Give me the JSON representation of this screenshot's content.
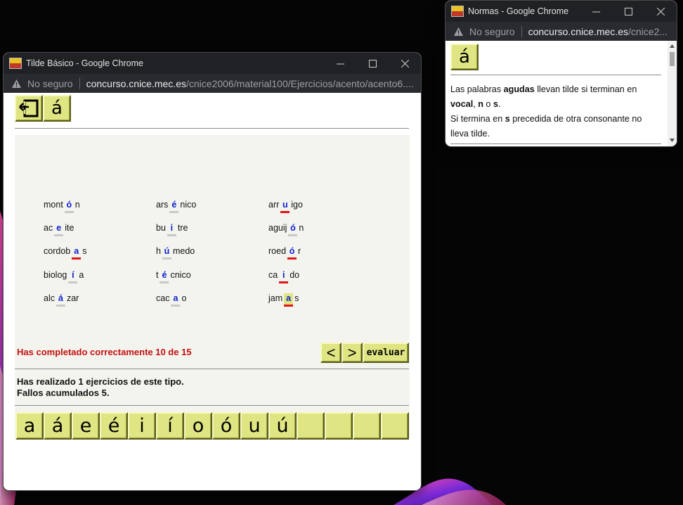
{
  "main_window": {
    "title": "Tilde Básico - Google Chrome",
    "security": "No seguro",
    "url_host": "concurso.cnice.mec.es",
    "url_path": "/cnice2006/material100/Ejercicios/acento/acento6....",
    "exit_icon": "exit-icon",
    "accent_button": "á",
    "words": [
      {
        "pre": "mont",
        "letter": "ó",
        "post": "n",
        "state": "neutral"
      },
      {
        "pre": "ac",
        "letter": "e",
        "post": "ite",
        "state": "neutral"
      },
      {
        "pre": "cordob",
        "letter": "a",
        "post": "s",
        "state": "error"
      },
      {
        "pre": "biolog",
        "letter": "í",
        "post": "a",
        "state": "neutral"
      },
      {
        "pre": "alc",
        "letter": "á",
        "post": "zar",
        "state": "neutral"
      },
      {
        "pre": "ars",
        "letter": "é",
        "post": "nico",
        "state": "neutral"
      },
      {
        "pre": "bu",
        "letter": "i",
        "post": "tre",
        "state": "neutral"
      },
      {
        "pre": "h",
        "letter": "ú",
        "post": "medo",
        "state": "neutral"
      },
      {
        "pre": "t",
        "letter": "é",
        "post": "cnico",
        "state": "neutral"
      },
      {
        "pre": "cac",
        "letter": "a",
        "post": "o",
        "state": "neutral"
      },
      {
        "pre": "arr",
        "letter": "u",
        "post": "igo",
        "state": "error"
      },
      {
        "pre": "aguij",
        "letter": "ó",
        "post": "n",
        "state": "neutral"
      },
      {
        "pre": "roed",
        "letter": "ó",
        "post": "r",
        "state": "error"
      },
      {
        "pre": "ca",
        "letter": "i",
        "post": "do",
        "state": "error"
      },
      {
        "pre": "jam",
        "letter": "a",
        "post": "s",
        "state": "error-selected"
      }
    ],
    "status_text": "Has completado correctamente 10 de 15",
    "prev_label": "<",
    "next_label": ">",
    "evaluate_label": "evaluar",
    "info_line1": "Has realizado 1 ejercicios de este tipo.",
    "info_line2": "Fallos acumulados 5.",
    "keyboard": [
      "a",
      "á",
      "e",
      "é",
      "i",
      "í",
      "o",
      "ó",
      "u",
      "ú",
      "",
      "",
      "",
      ""
    ]
  },
  "rules_window": {
    "title": "Normas - Google Chrome",
    "security": "No seguro",
    "url_host": "concurso.cnice.mec.es",
    "url_path": "/cnice2...",
    "accent_button": "á",
    "rule_1a": "Las palabras ",
    "rule_1b": "agudas",
    "rule_1c": " llevan tilde si terminan en ",
    "rule_1d": "vocal",
    "rule_1e": ", ",
    "rule_1f": "n",
    "rule_1g": " o ",
    "rule_1h": "s",
    "rule_1i": ".",
    "rule_2a": "Si termina en ",
    "rule_2b": "s",
    "rule_2c": " precedida de otra consonante no lleva tilde."
  },
  "colors": {
    "key_yellow": "#dfe582",
    "error_red": "#e21515",
    "status_red": "#c41010",
    "accent_blue": "#0a1fd0"
  }
}
